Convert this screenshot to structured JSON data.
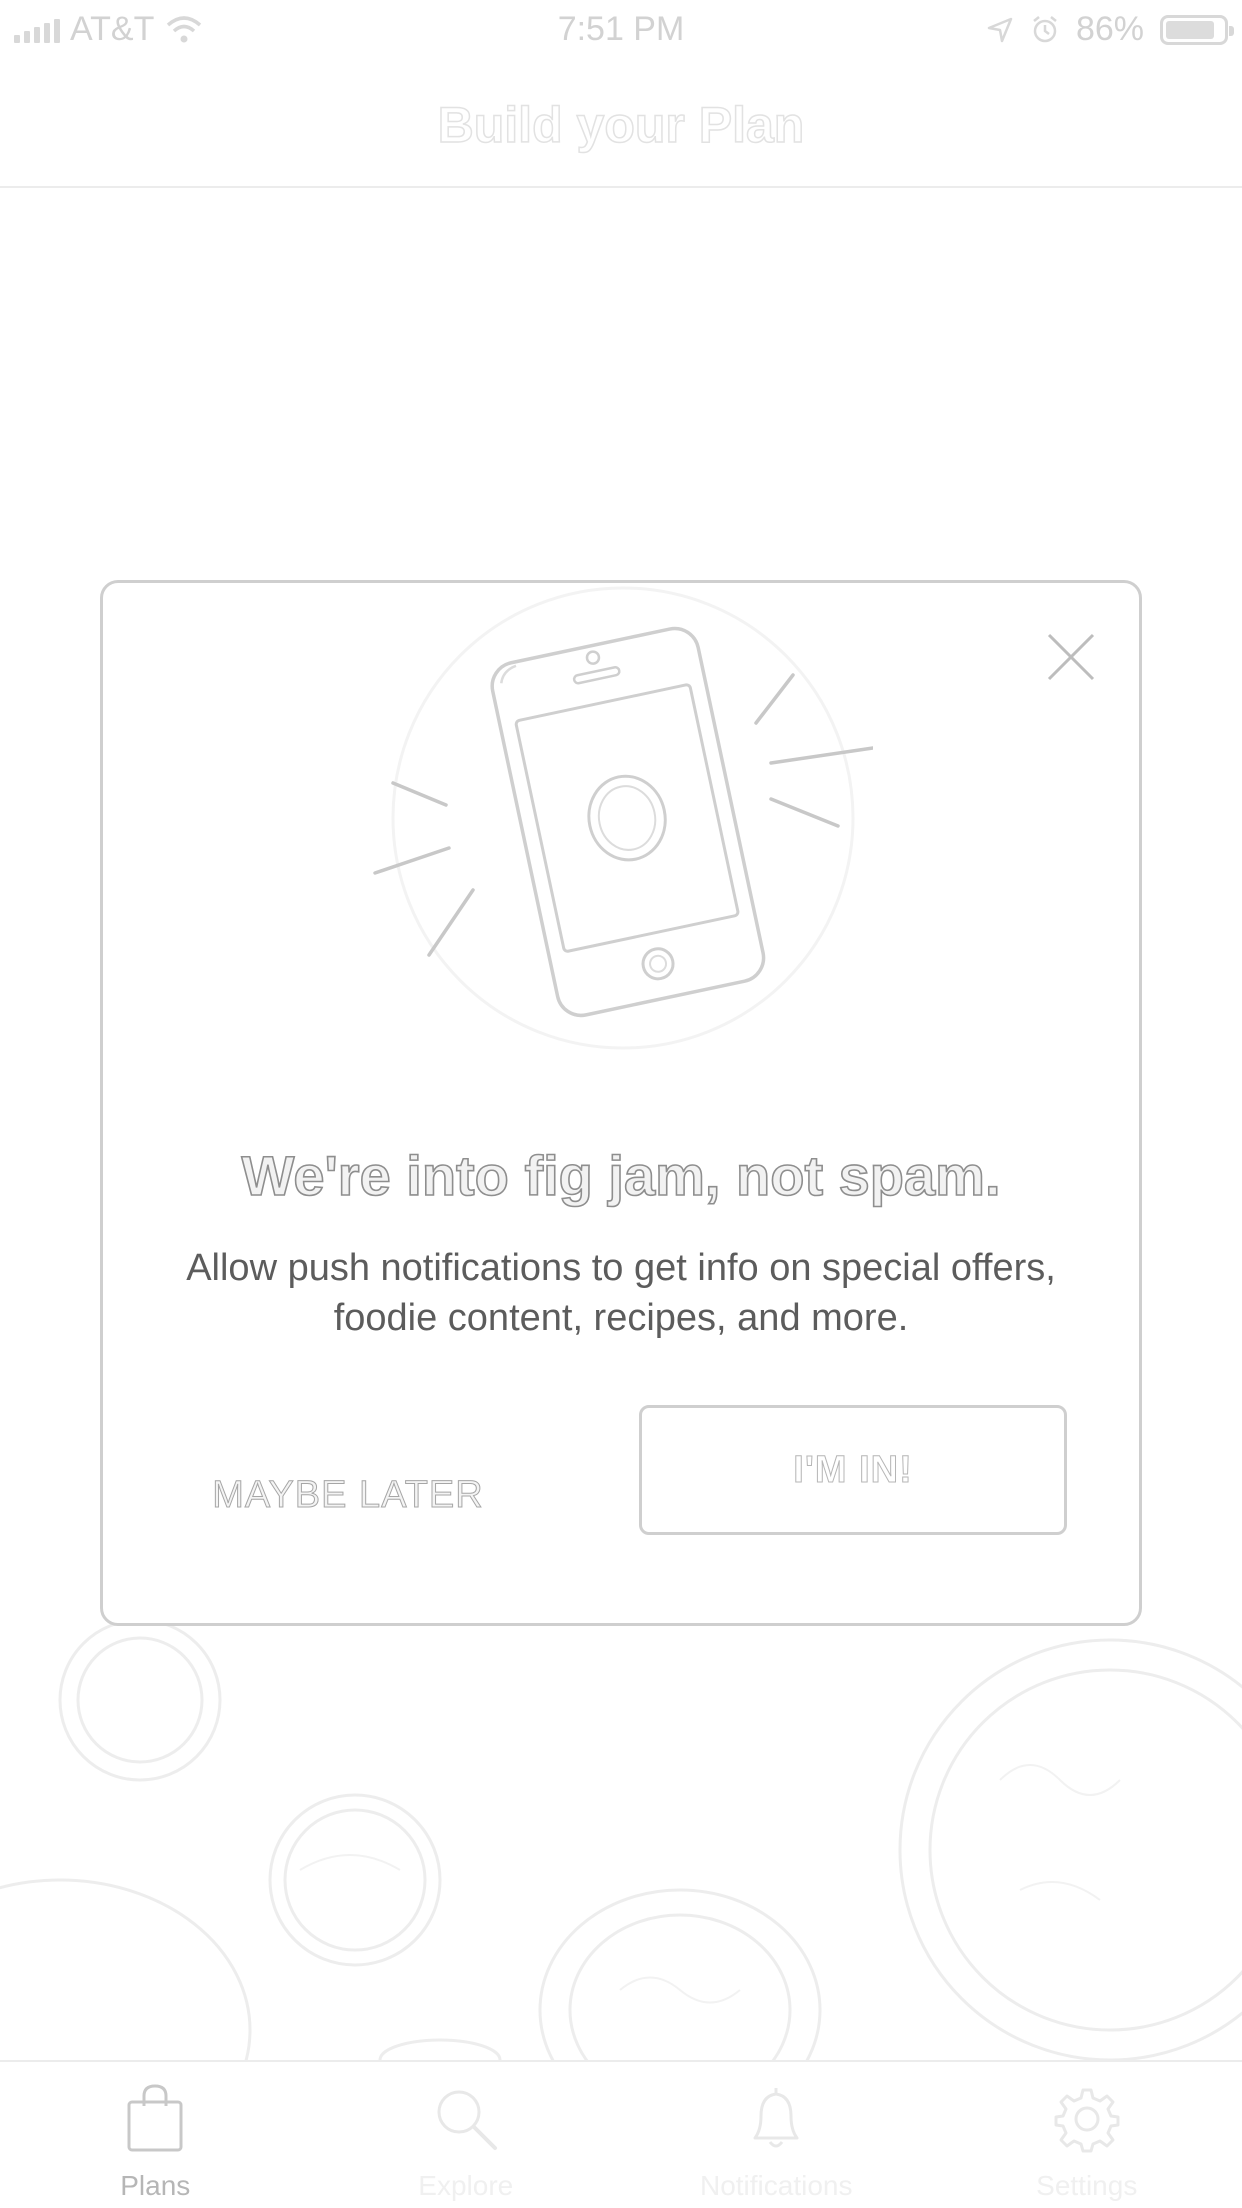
{
  "status_bar": {
    "carrier": "AT&T",
    "time": "7:51 PM",
    "battery": "86%",
    "battery_level": 0.86
  },
  "nav": {
    "title": "Build your Plan"
  },
  "modal": {
    "title": "We're into fig jam, not spam.",
    "body": "Allow push notifications to get info on special offers, foodie content, recipes, and more.",
    "maybe_later": "MAYBE LATER",
    "im_in": "I'M IN!",
    "icons": {
      "close": "close-icon",
      "illustration": "phone-notification-illustration"
    }
  },
  "tabs": [
    {
      "label": "Plans",
      "icon": "shopping-bag-icon",
      "active": true
    },
    {
      "label": "Explore",
      "icon": "search-icon",
      "active": false
    },
    {
      "label": "Notifications",
      "icon": "bell-icon",
      "active": false
    },
    {
      "label": "Settings",
      "icon": "gear-icon",
      "active": false
    }
  ],
  "colors": {
    "background": "#ffffff",
    "border": "#cfcfcf",
    "text": "#5c5c5c"
  }
}
